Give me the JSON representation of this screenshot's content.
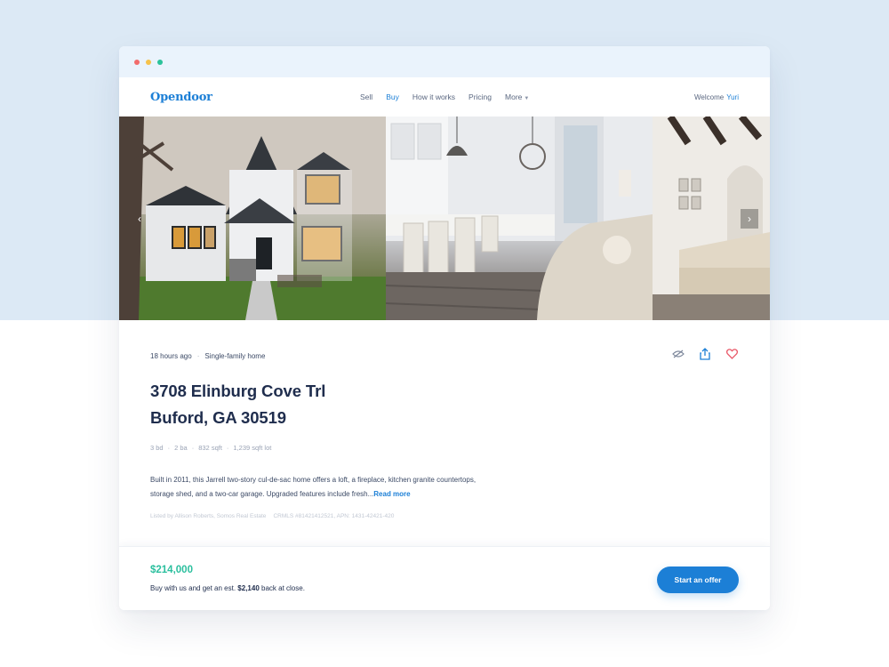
{
  "colors": {
    "brand": "#1c7fd6",
    "price": "#2bbf9e",
    "heart": "#e95a6a",
    "dot_red": "#f26c6c",
    "dot_yellow": "#f6c24a",
    "dot_green": "#2bc29a"
  },
  "header": {
    "logo": "Opendoor",
    "nav": [
      {
        "label": "Sell",
        "active": false
      },
      {
        "label": "Buy",
        "active": true
      },
      {
        "label": "How it works",
        "active": false
      },
      {
        "label": "Pricing",
        "active": false
      },
      {
        "label": "More",
        "active": false
      }
    ],
    "welcome_text": "Welcome",
    "user_name": "Yuri"
  },
  "gallery": {
    "prev_icon": "chevron-left-icon",
    "next_icon": "chevron-right-icon"
  },
  "listing": {
    "posted": "18 hours ago",
    "type": "Single-family home",
    "address_line1": "3708 Elinburg Cove Trl",
    "address_line2": "Buford, GA 30519",
    "specs": [
      "3 bd",
      "2 ba",
      "832 sqft",
      "1,239 sqft lot"
    ],
    "description": "Built in 2011, this Jarrell two-story cul-de-sac home offers a loft, a fireplace, kitchen granite countertops, storage shed, and a two-car garage. Upgraded features include fresh...",
    "read_more": "Read more",
    "listed_by": "Listed by Allison Roberts, Somos Real Estate",
    "mls": "CRMLS #81421412521, APN: 1431-42421-420",
    "actions": [
      "hide-icon",
      "share-icon",
      "heart-icon"
    ]
  },
  "footer": {
    "price": "$214,000",
    "cashback_prefix": "Buy with us and get an est.",
    "cashback_amount": "$2,140",
    "cashback_suffix": "back at close.",
    "cta": "Start an offer"
  }
}
